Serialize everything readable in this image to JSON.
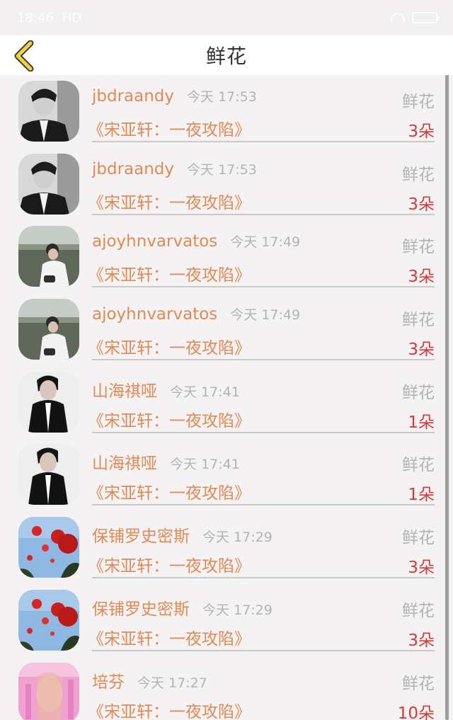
{
  "status_bar": {
    "time": "18:46",
    "network": "HD"
  },
  "header": {
    "title": "鲜花",
    "back_icon": "chevron-left-icon",
    "back_icon_color": "#f4d03f"
  },
  "colors": {
    "username": "#e08a55",
    "count": "#d53a3a",
    "muted": "#b3b3b3"
  },
  "items": [
    {
      "username": "jbdraandy",
      "time": "今天 17:53",
      "type": "鲜花",
      "book": "《宋亚轩：一夜攻陷》",
      "count": "3朵",
      "avatar": "avatar-man-suit"
    },
    {
      "username": "jbdraandy",
      "time": "今天 17:53",
      "type": "鲜花",
      "book": "《宋亚轩：一夜攻陷》",
      "count": "3朵",
      "avatar": "avatar-man-suit"
    },
    {
      "username": "ajoyhnvarvatos",
      "time": "今天 17:49",
      "type": "鲜花",
      "book": "《宋亚轩：一夜攻陷》",
      "count": "3朵",
      "avatar": "avatar-man-seaside"
    },
    {
      "username": "ajoyhnvarvatos",
      "time": "今天 17:49",
      "type": "鲜花",
      "book": "《宋亚轩：一夜攻陷》",
      "count": "3朵",
      "avatar": "avatar-man-seaside"
    },
    {
      "username": "山海祺哑",
      "time": "今天 17:41",
      "type": "鲜花",
      "book": "《宋亚轩：一夜攻陷》",
      "count": "1朵",
      "avatar": "avatar-man-black-jacket"
    },
    {
      "username": "山海祺哑",
      "time": "今天 17:41",
      "type": "鲜花",
      "book": "《宋亚轩：一夜攻陷》",
      "count": "1朵",
      "avatar": "avatar-man-black-jacket"
    },
    {
      "username": "保铺罗史密斯",
      "time": "今天 17:29",
      "type": "鲜花",
      "book": "《宋亚轩：一夜攻陷》",
      "count": "3朵",
      "avatar": "avatar-red-balloons"
    },
    {
      "username": "保铺罗史密斯",
      "time": "今天 17:29",
      "type": "鲜花",
      "book": "《宋亚轩：一夜攻陷》",
      "count": "3朵",
      "avatar": "avatar-red-balloons"
    },
    {
      "username": "培芬",
      "time": "今天 17:27",
      "type": "鲜花",
      "book": "《宋亚轩：一夜攻陷》",
      "count": "10朵",
      "avatar": "avatar-pink-figure"
    }
  ]
}
